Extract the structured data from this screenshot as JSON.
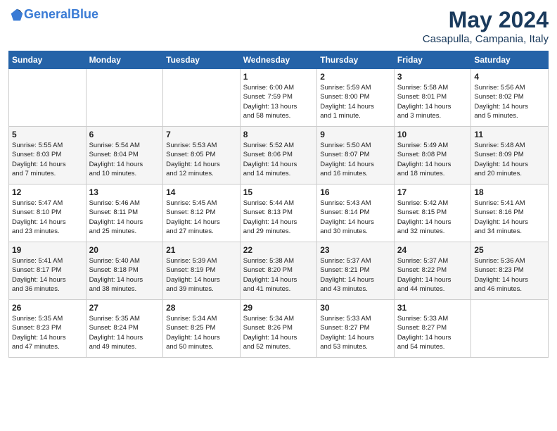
{
  "logo": {
    "text_general": "General",
    "text_blue": "Blue"
  },
  "title": "May 2024",
  "location": "Casapulla, Campania, Italy",
  "days_header": [
    "Sunday",
    "Monday",
    "Tuesday",
    "Wednesday",
    "Thursday",
    "Friday",
    "Saturday"
  ],
  "weeks": [
    [
      {
        "day": "",
        "info": ""
      },
      {
        "day": "",
        "info": ""
      },
      {
        "day": "",
        "info": ""
      },
      {
        "day": "1",
        "info": "Sunrise: 6:00 AM\nSunset: 7:59 PM\nDaylight: 13 hours\nand 58 minutes."
      },
      {
        "day": "2",
        "info": "Sunrise: 5:59 AM\nSunset: 8:00 PM\nDaylight: 14 hours\nand 1 minute."
      },
      {
        "day": "3",
        "info": "Sunrise: 5:58 AM\nSunset: 8:01 PM\nDaylight: 14 hours\nand 3 minutes."
      },
      {
        "day": "4",
        "info": "Sunrise: 5:56 AM\nSunset: 8:02 PM\nDaylight: 14 hours\nand 5 minutes."
      }
    ],
    [
      {
        "day": "5",
        "info": "Sunrise: 5:55 AM\nSunset: 8:03 PM\nDaylight: 14 hours\nand 7 minutes."
      },
      {
        "day": "6",
        "info": "Sunrise: 5:54 AM\nSunset: 8:04 PM\nDaylight: 14 hours\nand 10 minutes."
      },
      {
        "day": "7",
        "info": "Sunrise: 5:53 AM\nSunset: 8:05 PM\nDaylight: 14 hours\nand 12 minutes."
      },
      {
        "day": "8",
        "info": "Sunrise: 5:52 AM\nSunset: 8:06 PM\nDaylight: 14 hours\nand 14 minutes."
      },
      {
        "day": "9",
        "info": "Sunrise: 5:50 AM\nSunset: 8:07 PM\nDaylight: 14 hours\nand 16 minutes."
      },
      {
        "day": "10",
        "info": "Sunrise: 5:49 AM\nSunset: 8:08 PM\nDaylight: 14 hours\nand 18 minutes."
      },
      {
        "day": "11",
        "info": "Sunrise: 5:48 AM\nSunset: 8:09 PM\nDaylight: 14 hours\nand 20 minutes."
      }
    ],
    [
      {
        "day": "12",
        "info": "Sunrise: 5:47 AM\nSunset: 8:10 PM\nDaylight: 14 hours\nand 23 minutes."
      },
      {
        "day": "13",
        "info": "Sunrise: 5:46 AM\nSunset: 8:11 PM\nDaylight: 14 hours\nand 25 minutes."
      },
      {
        "day": "14",
        "info": "Sunrise: 5:45 AM\nSunset: 8:12 PM\nDaylight: 14 hours\nand 27 minutes."
      },
      {
        "day": "15",
        "info": "Sunrise: 5:44 AM\nSunset: 8:13 PM\nDaylight: 14 hours\nand 29 minutes."
      },
      {
        "day": "16",
        "info": "Sunrise: 5:43 AM\nSunset: 8:14 PM\nDaylight: 14 hours\nand 30 minutes."
      },
      {
        "day": "17",
        "info": "Sunrise: 5:42 AM\nSunset: 8:15 PM\nDaylight: 14 hours\nand 32 minutes."
      },
      {
        "day": "18",
        "info": "Sunrise: 5:41 AM\nSunset: 8:16 PM\nDaylight: 14 hours\nand 34 minutes."
      }
    ],
    [
      {
        "day": "19",
        "info": "Sunrise: 5:41 AM\nSunset: 8:17 PM\nDaylight: 14 hours\nand 36 minutes."
      },
      {
        "day": "20",
        "info": "Sunrise: 5:40 AM\nSunset: 8:18 PM\nDaylight: 14 hours\nand 38 minutes."
      },
      {
        "day": "21",
        "info": "Sunrise: 5:39 AM\nSunset: 8:19 PM\nDaylight: 14 hours\nand 39 minutes."
      },
      {
        "day": "22",
        "info": "Sunrise: 5:38 AM\nSunset: 8:20 PM\nDaylight: 14 hours\nand 41 minutes."
      },
      {
        "day": "23",
        "info": "Sunrise: 5:37 AM\nSunset: 8:21 PM\nDaylight: 14 hours\nand 43 minutes."
      },
      {
        "day": "24",
        "info": "Sunrise: 5:37 AM\nSunset: 8:22 PM\nDaylight: 14 hours\nand 44 minutes."
      },
      {
        "day": "25",
        "info": "Sunrise: 5:36 AM\nSunset: 8:23 PM\nDaylight: 14 hours\nand 46 minutes."
      }
    ],
    [
      {
        "day": "26",
        "info": "Sunrise: 5:35 AM\nSunset: 8:23 PM\nDaylight: 14 hours\nand 47 minutes."
      },
      {
        "day": "27",
        "info": "Sunrise: 5:35 AM\nSunset: 8:24 PM\nDaylight: 14 hours\nand 49 minutes."
      },
      {
        "day": "28",
        "info": "Sunrise: 5:34 AM\nSunset: 8:25 PM\nDaylight: 14 hours\nand 50 minutes."
      },
      {
        "day": "29",
        "info": "Sunrise: 5:34 AM\nSunset: 8:26 PM\nDaylight: 14 hours\nand 52 minutes."
      },
      {
        "day": "30",
        "info": "Sunrise: 5:33 AM\nSunset: 8:27 PM\nDaylight: 14 hours\nand 53 minutes."
      },
      {
        "day": "31",
        "info": "Sunrise: 5:33 AM\nSunset: 8:27 PM\nDaylight: 14 hours\nand 54 minutes."
      },
      {
        "day": "",
        "info": ""
      }
    ]
  ]
}
